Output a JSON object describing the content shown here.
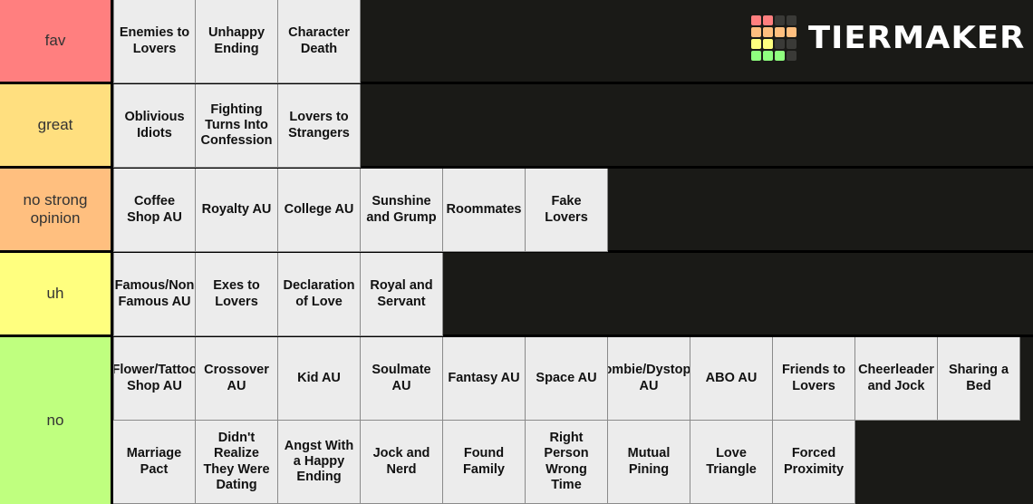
{
  "brand": {
    "name": "TIERMAKER",
    "logo_icon": "tiermaker-grid-logo",
    "grid_colors": [
      "#ff7f7f",
      "#ff7f7f",
      "#3a3a37",
      "#3a3a37",
      "#ffbf7f",
      "#ffbf7f",
      "#ffbf7f",
      "#ffbf7f",
      "#ffff7f",
      "#ffff7f",
      "#3a3a37",
      "#3a3a37",
      "#8fff7f",
      "#8fff7f",
      "#8fff7f",
      "#3a3a37"
    ]
  },
  "background_color": "#1a1a17",
  "tile_color": "#ececec",
  "tiers": [
    {
      "label": "fav",
      "color": "#ff7f7f",
      "items": [
        "Enemies to\nLovers",
        "Unhappy\nEnding",
        "Character\nDeath"
      ]
    },
    {
      "label": "great",
      "color": "#ffdf7f",
      "items": [
        "Oblivious\nIdiots",
        "Fighting\nTurns Into\nConfession",
        "Lovers to\nStrangers"
      ]
    },
    {
      "label": "no strong opinion",
      "color": "#ffbf7f",
      "items": [
        "Coffee\nShop AU",
        "Royalty AU",
        "College AU",
        "Sunshine\nand Grump",
        "Roommates",
        "Fake\nLovers"
      ]
    },
    {
      "label": "uh",
      "color": "#ffff7f",
      "items": [
        "Famous/Non\nFamous AU",
        "Exes to\nLovers",
        "Declaration\nof Love",
        "Royal and\nServant"
      ]
    },
    {
      "label": "no",
      "color": "#bfff7f",
      "items": [
        "Flower/Tattoo\nShop AU",
        "Crossover\nAU",
        "Kid AU",
        "Soulmate\nAU",
        "Fantasy AU",
        "Space AU",
        "Zombie/Dystopia\nAU",
        "ABO AU",
        "Friends to\nLovers",
        "Cheerleader\nand Jock",
        "Sharing a\nBed",
        "Marriage\nPact",
        "Didn't\nRealize\nThey Were\nDating",
        "Angst With\na Happy\nEnding",
        "Jock and\nNerd",
        "Found\nFamily",
        "Right\nPerson\nWrong\nTime",
        "Mutual\nPining",
        "Love\nTriangle",
        "Forced\nProximity"
      ]
    }
  ]
}
